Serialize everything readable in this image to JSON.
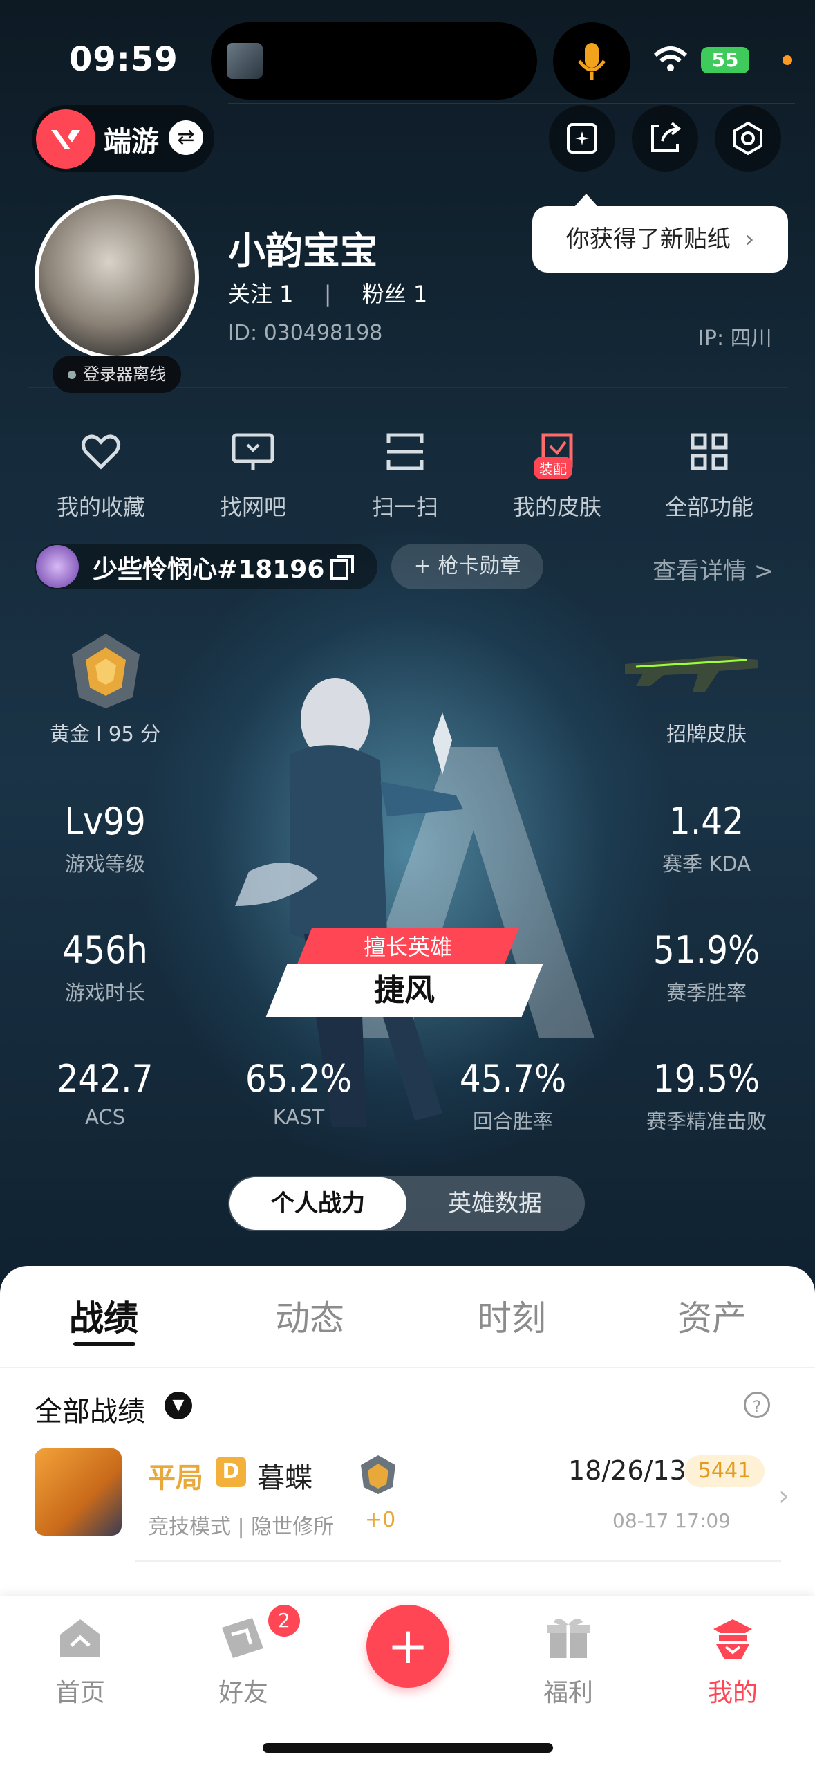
{
  "status_bar": {
    "time": "09:59",
    "battery": "55"
  },
  "header": {
    "app_label": "端游",
    "tooltip": "你获得了新贴纸"
  },
  "profile": {
    "name": "小韵宝宝",
    "follow_text": "关注 1",
    "fans_text": "粉丝 1",
    "separator": "|",
    "id_text": "ID: 030498198",
    "ip_text": "IP: 四川",
    "status": "登录器离线"
  },
  "quick_actions": [
    {
      "label": "我的收藏",
      "icon": "heart-icon"
    },
    {
      "label": "找网吧",
      "icon": "monitor-icon"
    },
    {
      "label": "扫一扫",
      "icon": "scan-icon"
    },
    {
      "label": "我的皮肤",
      "icon": "skin-icon",
      "badge": "装配"
    },
    {
      "label": "全部功能",
      "icon": "grid-icon"
    }
  ],
  "account": {
    "name": "少些怜悯心#18196",
    "badge_button": "+ 枪卡勋章",
    "detail_link": "查看详情 >"
  },
  "stats": {
    "rank": "黄金 I 95 分",
    "skin_label": "招牌皮肤",
    "level": {
      "value": "Lv99",
      "label": "游戏等级"
    },
    "kda": {
      "value": "1.42",
      "label": "赛季 KDA"
    },
    "hours": {
      "value": "456h",
      "label": "游戏时长"
    },
    "winrate": {
      "value": "51.9%",
      "label": "赛季胜率"
    },
    "acs": {
      "value": "242.7",
      "label": "ACS"
    },
    "kast": {
      "value": "65.2%",
      "label": "KAST"
    },
    "round_win": {
      "value": "45.7%",
      "label": "回合胜率"
    },
    "precise_kill": {
      "value": "19.5%",
      "label": "赛季精准击败"
    }
  },
  "hero": {
    "tag": "擅长英雄",
    "name": "捷风"
  },
  "segments": {
    "active": "个人战力",
    "inactive": "英雄数据"
  },
  "tabs": [
    "战绩",
    "动态",
    "时刻",
    "资产"
  ],
  "filter": {
    "label": "全部战绩"
  },
  "match": {
    "result": "平局",
    "grade": "D",
    "map": "暮蝶",
    "delta": "+0",
    "mode": "竞技模式 | 隐世修所",
    "kda": "18/26/13",
    "score": "5441",
    "time": "08-17 17:09"
  },
  "nav": [
    {
      "label": "首页",
      "icon": "home-icon"
    },
    {
      "label": "好友",
      "icon": "friends-icon",
      "badge": "2"
    },
    {
      "label": "福利",
      "icon": "gift-icon"
    },
    {
      "label": "我的",
      "icon": "profile-icon"
    }
  ],
  "colors": {
    "accent": "#ff4655",
    "gold": "#e9a93a"
  }
}
